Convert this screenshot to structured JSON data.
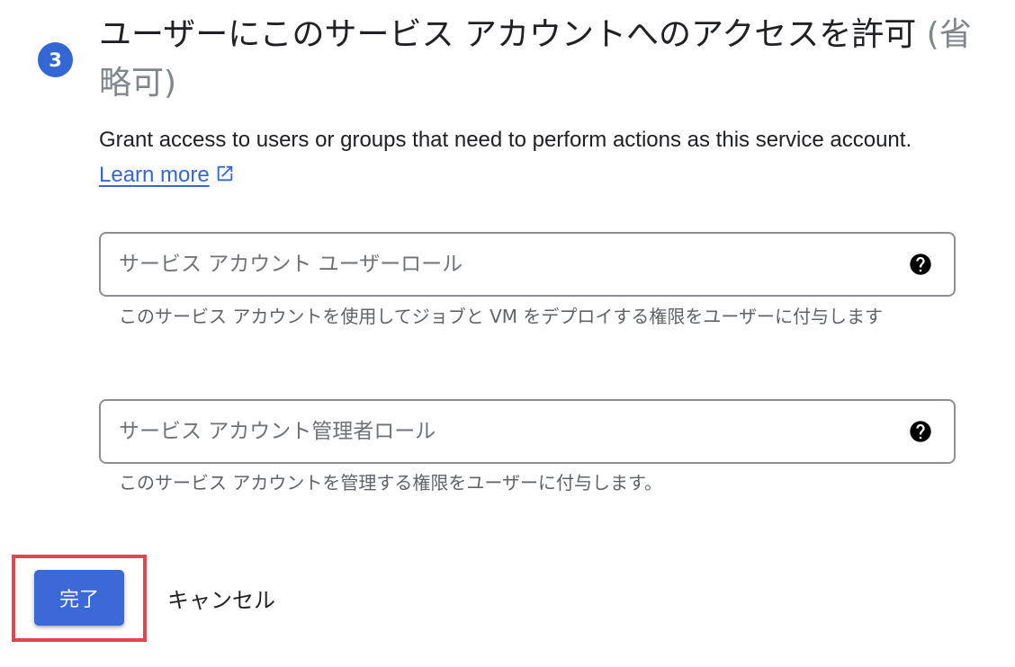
{
  "step": {
    "number": "3",
    "title_main": "ユーザーにこのサービス アカウントへのアクセスを許可",
    "title_optional": "(省略可)",
    "description": "Grant access to users or groups that need to perform actions as this service account.",
    "learn_more": "Learn more"
  },
  "fields": {
    "user_role": {
      "placeholder": "サービス アカウント ユーザーロール",
      "value": "",
      "hint": "このサービス アカウントを使用してジョブと VM をデプロイする権限をユーザーに付与します"
    },
    "admin_role": {
      "placeholder": "サービス アカウント管理者ロール",
      "value": "",
      "hint": "このサービス アカウントを管理する権限をユーザーに付与します。"
    }
  },
  "actions": {
    "done_label": "完了",
    "cancel_label": "キャンセル"
  },
  "icons": {
    "external_link": "open-in-new-icon",
    "help": "help-circle-icon"
  },
  "colors": {
    "accent": "#3367d6",
    "highlight": "#e2474f"
  }
}
